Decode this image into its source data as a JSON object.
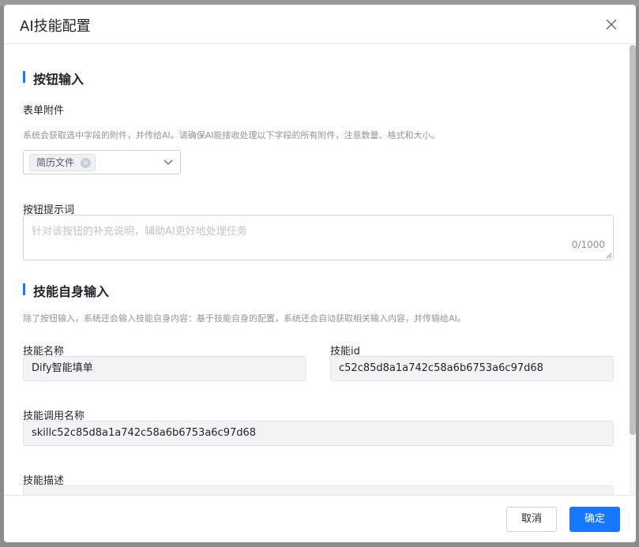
{
  "modal": {
    "title": "AI技能配置",
    "close_icon": "close-icon"
  },
  "button_input": {
    "section_title": "按钮输入",
    "attachments": {
      "label": "表单附件",
      "hint": "系统会获取选中字段的附件，并传给AI。请确保AI能接收处理以下字段的所有附件，注意数量、格式和大小。",
      "selected_tag": "简历文件"
    },
    "prompt": {
      "label": "按钮提示词",
      "placeholder": "针对该按钮的补充说明，辅助AI更好地处理任务",
      "counter": "0/1000"
    }
  },
  "skill_input": {
    "section_title": "技能自身输入",
    "hint": "除了按钮输入，系统还会输入技能自身内容：基于技能自身的配置，系统还会自动获取相关输入内容，并传输给AI。",
    "skill_name": {
      "label": "技能名称",
      "value": "Dify智能填单"
    },
    "skill_id": {
      "label": "技能id",
      "value": "c52c85d8a1a742c58a6b6753a6c97d68"
    },
    "invoke_name": {
      "label": "技能调用名称",
      "value": "skillc52c85d8a1a742c58a6b6753a6c97d68"
    },
    "description": {
      "label": "技能描述",
      "value": ""
    }
  },
  "footer": {
    "cancel_label": "取消",
    "ok_label": "确定"
  },
  "colors": {
    "accent": "#1677ff",
    "overlay": "#8c8c8c"
  }
}
